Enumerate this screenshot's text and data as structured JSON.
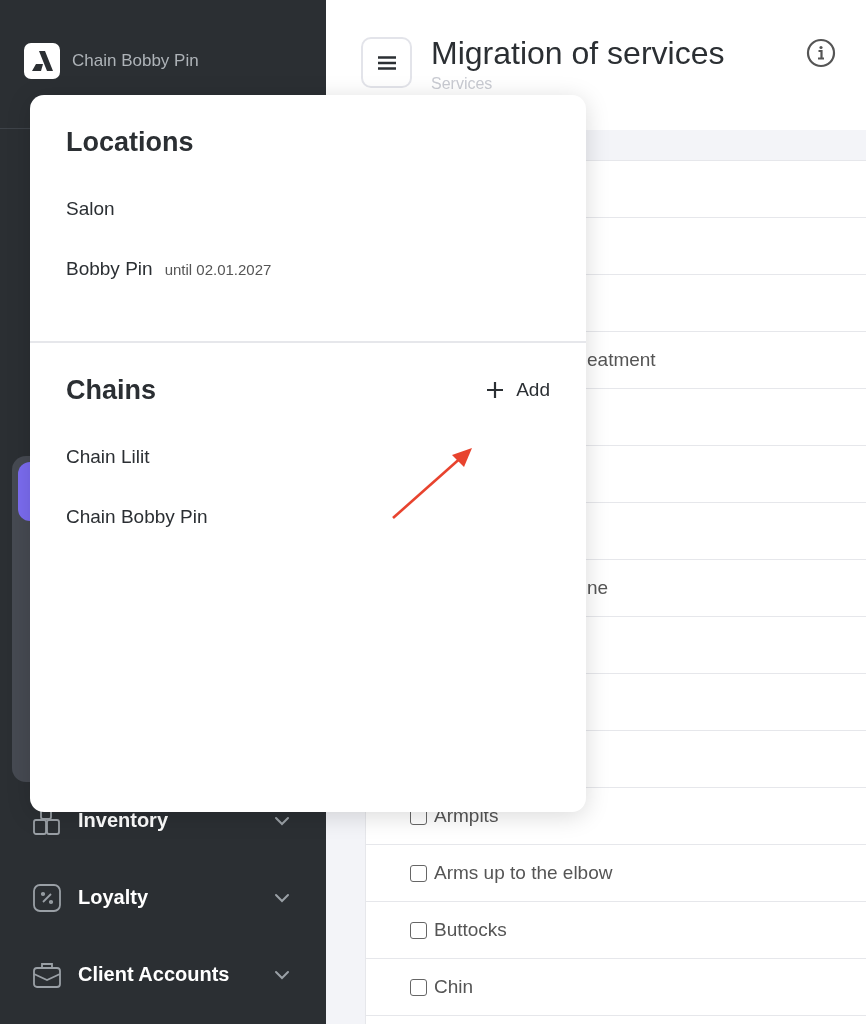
{
  "sidebar": {
    "brand": "Chain Bobby Pin",
    "nav_items": [
      {
        "label": "Inventory",
        "kind": "boxes"
      },
      {
        "label": "Loyalty",
        "kind": "percent"
      },
      {
        "label": "Client Accounts",
        "kind": "briefcase"
      }
    ]
  },
  "header": {
    "title": "Migration of services",
    "subtitle": "Services"
  },
  "table": {
    "rows": [
      {
        "kind": "blank"
      },
      {
        "kind": "blank"
      },
      {
        "kind": "blank"
      },
      {
        "kind": "clipped",
        "text": "eatment"
      },
      {
        "kind": "blank"
      },
      {
        "kind": "blank"
      },
      {
        "kind": "blank"
      },
      {
        "kind": "clipped",
        "text": "ne"
      },
      {
        "kind": "blank"
      },
      {
        "kind": "blank"
      },
      {
        "kind": "blank"
      },
      {
        "kind": "item",
        "text": "Armpits",
        "checked": false
      },
      {
        "kind": "item",
        "text": "Arms up to the elbow",
        "checked": false
      },
      {
        "kind": "item",
        "text": "Buttocks",
        "checked": false
      },
      {
        "kind": "item",
        "text": "Chin",
        "checked": false
      }
    ]
  },
  "popover": {
    "locations": {
      "title": "Locations",
      "items": [
        {
          "name": "Salon"
        },
        {
          "name": "Bobby Pin",
          "note": "until 02.01.2027"
        }
      ]
    },
    "chains": {
      "title": "Chains",
      "add_label": "Add",
      "items": [
        {
          "name": "Chain Lilit"
        },
        {
          "name": "Chain Bobby Pin"
        }
      ]
    }
  }
}
